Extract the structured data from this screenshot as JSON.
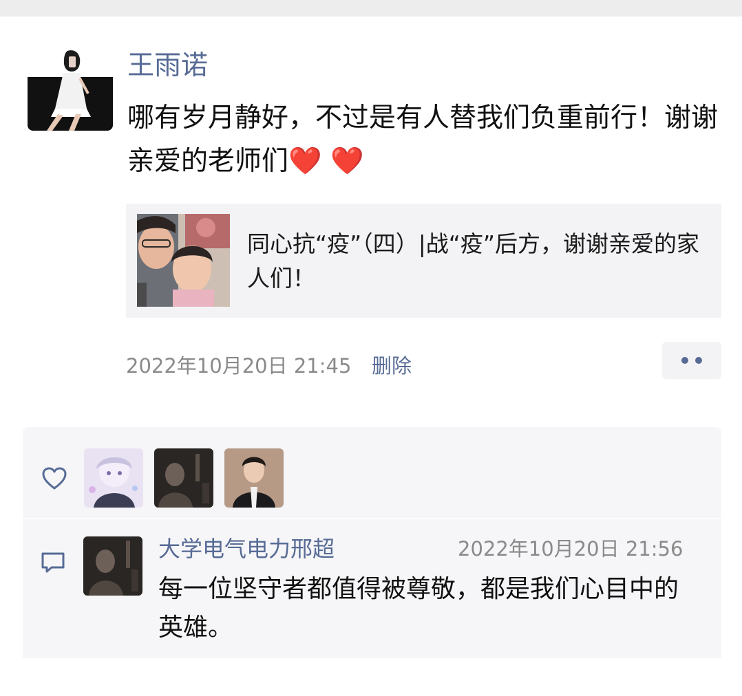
{
  "post": {
    "author": "王雨诺",
    "text": "哪有岁月静好，不过是有人替我们负重前行！谢谢亲爱的老师们",
    "emoji": "❤️ ❤️",
    "link_title": "同心抗“疫”（四）|战“疫”后方，谢谢亲爱的家人们！",
    "timestamp": "2022年10月20日 21:45",
    "delete_label": "删除"
  },
  "comment": {
    "author": "大学电气电力邢超",
    "time": "2022年10月20日 21:56",
    "text": "每一位坚守者都值得被尊敬，都是我们心目中的英雄。"
  },
  "icons": {
    "like": "heart-outline-icon",
    "comment": "comment-bubble-icon",
    "more": "more-dots-icon"
  },
  "colors": {
    "name_link": "#576b95",
    "timestamp": "#8a8a8a",
    "panel": "#f6f6f8",
    "heart": "#e3262d"
  }
}
